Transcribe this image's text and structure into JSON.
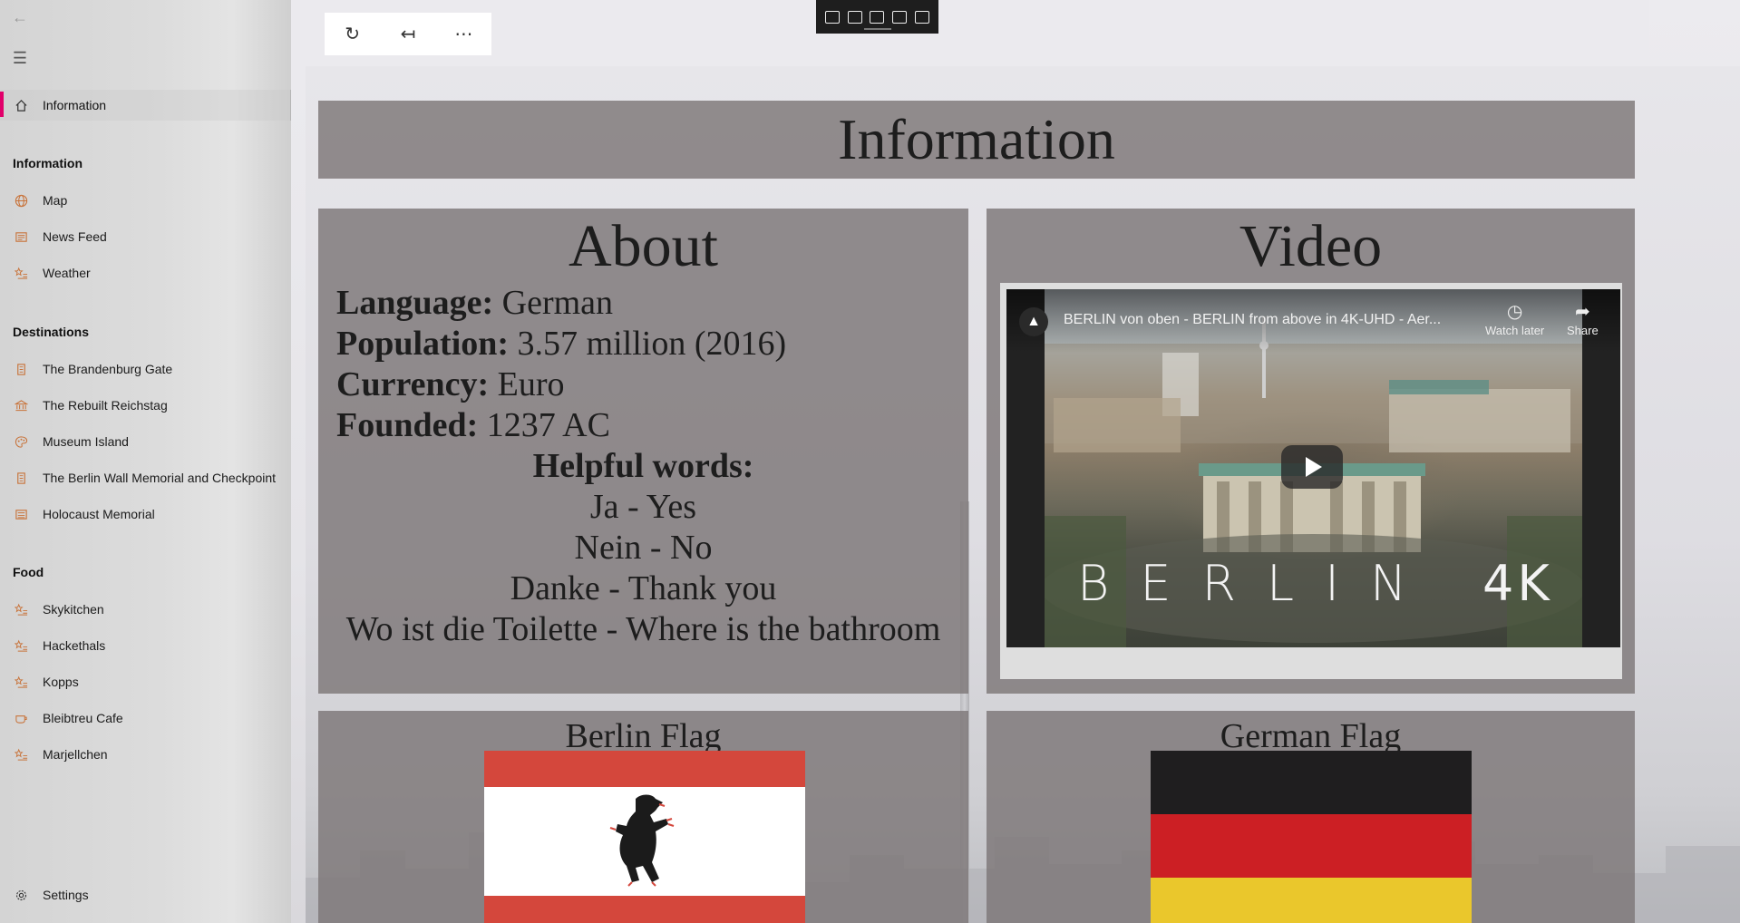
{
  "sidebar": {
    "selected_item": "Information",
    "sections": [
      {
        "header": "Information",
        "items": [
          "Map",
          "News Feed",
          "Weather"
        ]
      },
      {
        "header": "Destinations",
        "items": [
          "The Brandenburg Gate",
          "The Rebuilt Reichstag",
          "Museum Island",
          "The Berlin Wall Memorial and Checkpoint",
          "Holocaust Memorial"
        ]
      },
      {
        "header": "Food",
        "items": [
          "Skykitchen",
          "Hackethals",
          "Kopps",
          "Bleibtreu Cafe",
          "Marjellchen"
        ]
      }
    ],
    "settings_label": "Settings",
    "accent_color": "#e1006a",
    "icon_color": "#c8733a"
  },
  "toolbar": {
    "refresh_icon": "refresh-icon",
    "back_icon": "back-arrow-icon",
    "more_icon": "more-icon"
  },
  "page": {
    "title": "Information",
    "about": {
      "heading": "About",
      "facts": [
        {
          "label": "Language:",
          "value": " German"
        },
        {
          "label": "Population:",
          "value": " 3.57 million (2016)"
        },
        {
          "label": "Currency:",
          "value": " Euro"
        },
        {
          "label": "Founded:",
          "value": " 1237 AC"
        }
      ],
      "helpful_heading": "Helpful words:",
      "phrases": [
        "Ja - Yes",
        "Nein - No",
        "Danke - Thank you",
        "Wo ist die Toilette - Where is the bathroom"
      ]
    },
    "video": {
      "heading": "Video",
      "title": "BERLIN von oben - BERLIN from above in 4K-UHD - Aer...",
      "watch_later": "Watch later",
      "share": "Share",
      "overlay_text": "BERLIN",
      "overlay_suffix": "4K"
    },
    "berlin_flag": {
      "title": "Berlin Flag",
      "colors": [
        "#d4473c",
        "#ffffff",
        "#d4473c"
      ]
    },
    "german_flag": {
      "title": "German Flag",
      "colors": [
        "#1f1e1f",
        "#cc1f24",
        "#eac72c"
      ]
    }
  }
}
